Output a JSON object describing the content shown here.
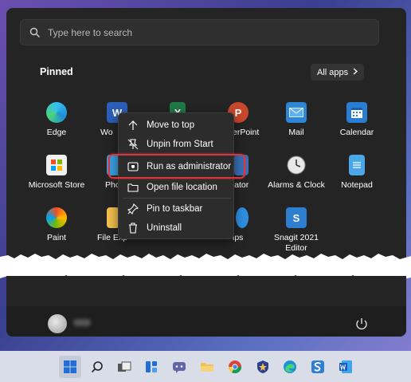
{
  "search": {
    "placeholder": "Type here to search"
  },
  "pinned": {
    "title": "Pinned",
    "all_apps_label": "All apps",
    "apps": [
      {
        "label": "Edge",
        "icon": "edge-icon",
        "color": "#1f8fd6"
      },
      {
        "label": "Wo",
        "icon": "word-icon",
        "color": "#2b5fb8"
      },
      {
        "label": "",
        "icon": "excel-icon",
        "color": "#1f7a45"
      },
      {
        "label": "erPoint",
        "icon": "powerpoint-icon",
        "color": "#c9472c"
      },
      {
        "label": "Mail",
        "icon": "mail-icon",
        "color": "#2e86d6"
      },
      {
        "label": "Calendar",
        "icon": "calendar-icon",
        "color": "#2b7cd3"
      },
      {
        "label": "Microsoft Store",
        "icon": "store-icon",
        "color": "#f0f0f0"
      },
      {
        "label": "Phot",
        "icon": "photos-icon",
        "color": "#3aa0e0"
      },
      {
        "label": "",
        "icon": "settings-icon",
        "color": "#555"
      },
      {
        "label": "ulator",
        "icon": "calculator-icon",
        "color": "#3b6fb5"
      },
      {
        "label": "Alarms & Clock",
        "icon": "clock-icon",
        "color": "#dcdcdc"
      },
      {
        "label": "Notepad",
        "icon": "notepad-icon",
        "color": "#4aa8e8"
      },
      {
        "label": "Paint",
        "icon": "paint-icon",
        "color": "#2f9bd8"
      },
      {
        "label": "File Exp",
        "icon": "file-explorer-icon",
        "color": "#f2c14e"
      },
      {
        "label": "",
        "icon": "blank-icon",
        "color": "#242424"
      },
      {
        "label": "ips",
        "icon": "tips-icon",
        "color": "#2f8fe0"
      },
      {
        "label": "Snagit 2021 Editor",
        "icon": "snagit-icon",
        "color": "#2f7fd0"
      }
    ]
  },
  "context_menu": {
    "items": [
      {
        "label": "Move to top",
        "icon": "arrow-up-icon"
      },
      {
        "label": "Unpin from Start",
        "icon": "unpin-icon"
      },
      {
        "label": "Run as administrator",
        "icon": "shield-icon"
      },
      {
        "label": "Open file location",
        "icon": "folder-icon"
      },
      {
        "label": "Pin to taskbar",
        "icon": "pin-icon"
      },
      {
        "label": "Uninstall",
        "icon": "trash-icon"
      }
    ]
  },
  "user": {
    "name": "···"
  },
  "colors": {
    "highlight": "#d9363e",
    "menu_bg": "#242424",
    "taskbar_bg": "#d9dde8"
  }
}
